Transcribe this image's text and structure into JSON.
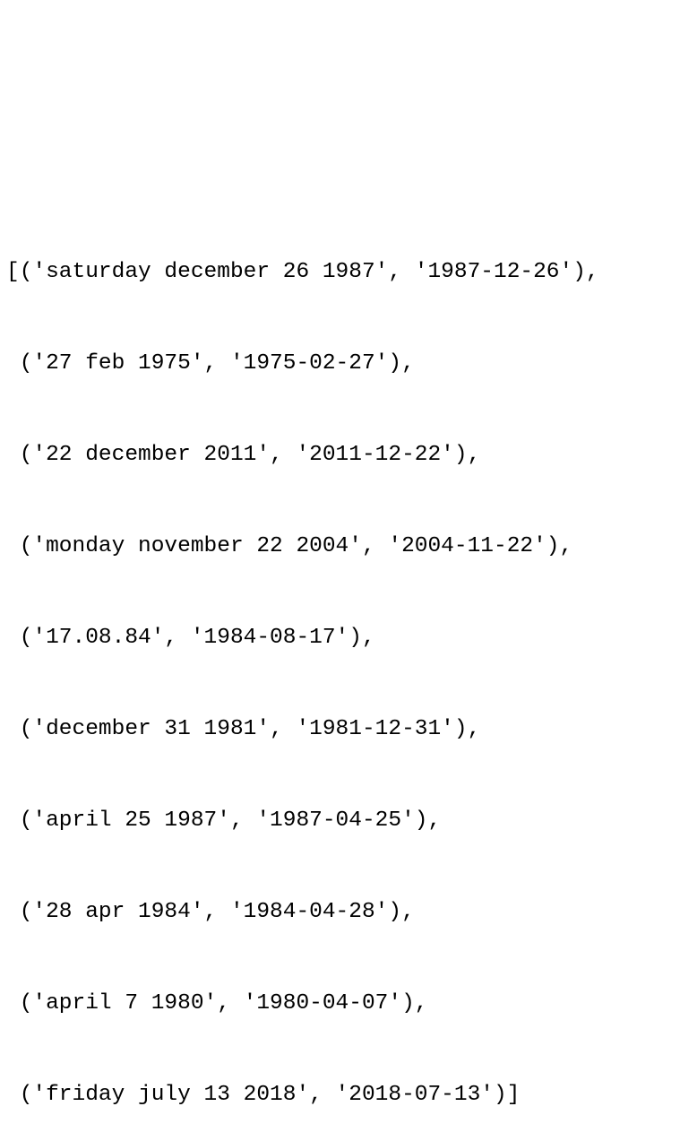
{
  "output": {
    "lines": [
      "[('saturday december 26 1987', '1987-12-26'),",
      " ('27 feb 1975', '1975-02-27'),",
      " ('22 december 2011', '2011-12-22'),",
      " ('monday november 22 2004', '2004-11-22'),",
      " ('17.08.84', '1984-08-17'),",
      " ('december 31 1981', '1981-12-31'),",
      " ('april 25 1987', '1987-04-25'),",
      " ('28 apr 1984', '1984-04-28'),",
      " ('april 7 1980', '1980-04-07'),",
      " ('friday july 13 2018', '2018-07-13')]"
    ]
  }
}
